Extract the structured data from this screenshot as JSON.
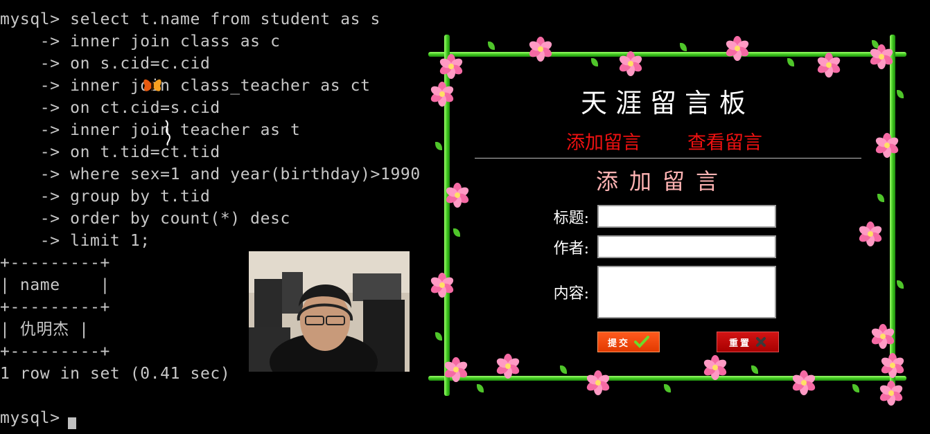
{
  "terminal": {
    "lines": [
      "mysql> select t.name from student as s",
      "    -> inner join class as c",
      "    -> on s.cid=c.cid",
      "    -> inner join class_teacher as ct",
      "    -> on ct.cid=s.cid",
      "    -> inner join teacher as t",
      "    -> on t.tid=ct.tid",
      "    -> where sex=1 and year(birthday)>1990",
      "    -> group by t.tid",
      "    -> order by count(*) desc",
      "    -> limit 1;",
      "+---------+",
      "| name    |",
      "+---------+",
      "| 仇明杰 |",
      "+---------+",
      "1 row in set (0.41 sec)",
      "",
      "mysql> "
    ]
  },
  "guestbook": {
    "title": "天涯留言板",
    "nav": {
      "add": "添加留言",
      "view": "查看留言"
    },
    "subtitle": "添加留言",
    "form": {
      "title_label": "标题:",
      "title_value": "",
      "author_label": "作者:",
      "author_value": "",
      "content_label": "内容:",
      "content_value": ""
    },
    "buttons": {
      "submit": "提交",
      "reset": "重置"
    },
    "colors": {
      "nav_text": "#ee1111",
      "subtitle_text": "#ffb3b3",
      "submit_bg": "#e84408",
      "reset_bg": "#c00000",
      "vine": "#3cc41c",
      "flower": "#ff80b4"
    }
  },
  "icons": {
    "submit": "checkmark-icon",
    "reset": "x-icon",
    "decoration": "flower-icon"
  }
}
